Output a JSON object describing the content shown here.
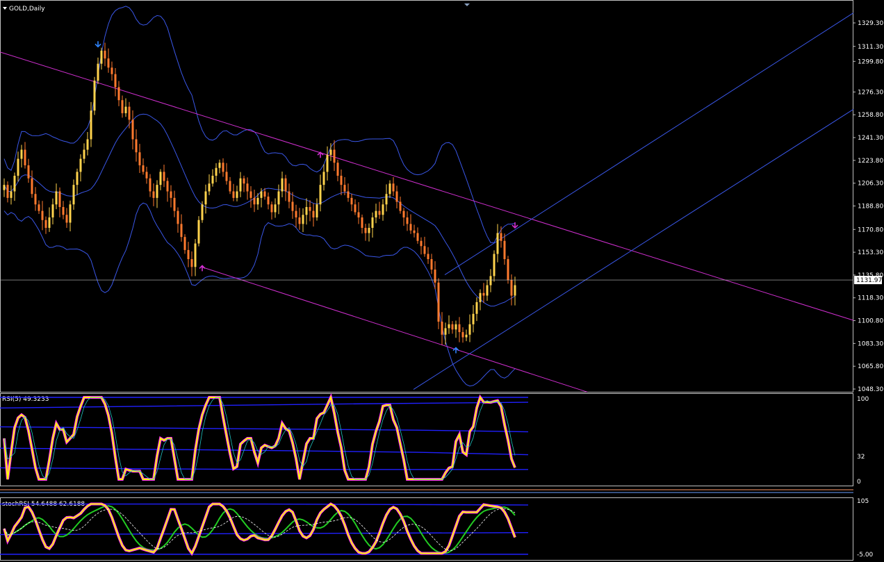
{
  "header": {
    "symbol_label": "GOLD,Daily"
  },
  "colors": {
    "background": "#000000",
    "grid_border": "#c0c0c0",
    "candle_up": "#ffd34d",
    "candle_down": "#ff7a2e",
    "bollinger": "#3a57e8",
    "channel_magenta": "#d02fd0",
    "channel_blue": "#3a57e8",
    "rsi_line": "#ffff00",
    "rsi_highlight": "#ff2aff",
    "stoch_main": "#ffff00",
    "stoch_signal": "#22cc22",
    "level_line": "#2020ff"
  },
  "price_axis": {
    "ticks": [
      "1329.30",
      "1311.30",
      "1299.80",
      "1276.30",
      "1258.80",
      "1241.30",
      "1223.80",
      "1206.30",
      "1188.80",
      "1170.80",
      "1153.30",
      "1135.80",
      "1118.30",
      "1100.80",
      "1083.30",
      "1065.80",
      "1048.30"
    ],
    "current_price": "1131.97"
  },
  "rsi_panel": {
    "label": "RSI(5) 49.3233",
    "ticks": [
      "100",
      "32",
      "0"
    ]
  },
  "stoch_panel": {
    "label": "stochRSI 54.6488 62.6188",
    "ticks": [
      "105",
      "-5.00"
    ]
  },
  "chart_data": [
    {
      "type": "candlestick",
      "title": "GOLD,Daily",
      "ylim": [
        1040,
        1345
      ],
      "current_price": 1131.97,
      "close": [
        1205,
        1195,
        1200,
        1212,
        1225,
        1232,
        1220,
        1210,
        1198,
        1190,
        1185,
        1178,
        1172,
        1180,
        1190,
        1200,
        1188,
        1182,
        1176,
        1190,
        1205,
        1215,
        1225,
        1232,
        1240,
        1262,
        1285,
        1298,
        1308,
        1302,
        1295,
        1290,
        1280,
        1270,
        1260,
        1265,
        1255,
        1240,
        1230,
        1220,
        1215,
        1210,
        1200,
        1195,
        1205,
        1215,
        1208,
        1200,
        1195,
        1185,
        1175,
        1165,
        1155,
        1148,
        1142,
        1160,
        1178,
        1190,
        1200,
        1206,
        1212,
        1218,
        1222,
        1215,
        1208,
        1200,
        1195,
        1200,
        1210,
        1206,
        1200,
        1195,
        1190,
        1195,
        1200,
        1196,
        1190,
        1184,
        1190,
        1200,
        1210,
        1200,
        1192,
        1185,
        1180,
        1175,
        1182,
        1188,
        1185,
        1180,
        1190,
        1205,
        1215,
        1228,
        1232,
        1222,
        1212,
        1205,
        1200,
        1195,
        1190,
        1184,
        1180,
        1172,
        1168,
        1172,
        1180,
        1185,
        1182,
        1190,
        1198,
        1206,
        1200,
        1192,
        1185,
        1180,
        1175,
        1170,
        1168,
        1162,
        1158,
        1152,
        1148,
        1140,
        1130,
        1100,
        1090,
        1095,
        1098,
        1094,
        1098,
        1092,
        1088,
        1090,
        1098,
        1106,
        1115,
        1122,
        1120,
        1128,
        1135,
        1152,
        1168,
        1162,
        1148,
        1132,
        1120,
        1128
      ],
      "markers": [
        {
          "type": "fractal-down",
          "color": "#2f86ff",
          "value": 1311.3
        },
        {
          "type": "fractal-up",
          "color": "#d02fd0",
          "value": 1232
        },
        {
          "type": "fractal-up",
          "color": "#d02fd0",
          "value": 1142
        },
        {
          "type": "fractal-up",
          "color": "#2f86ff",
          "value": 1078
        },
        {
          "type": "fractal-down",
          "color": "#d02fd0",
          "value": 1172
        }
      ],
      "trendlines": [
        {
          "name": "channel-upper",
          "color": "#d02fd0"
        },
        {
          "name": "channel-lower",
          "color": "#d02fd0"
        },
        {
          "name": "rising-channel-1",
          "color": "#3a57e8"
        },
        {
          "name": "rising-channel-2",
          "color": "#3a57e8"
        }
      ]
    },
    {
      "type": "line",
      "title": "RSI(5) 49.3233",
      "ylim": [
        0,
        100
      ],
      "levels": [
        32,
        100
      ],
      "current": 49.3233
    },
    {
      "type": "line",
      "title": "stochRSI 54.6488 62.6188",
      "ylim": [
        -5,
        105
      ],
      "series": [
        {
          "name": "stochRSI",
          "current": 54.6488
        },
        {
          "name": "signal",
          "current": 62.6188
        }
      ]
    }
  ]
}
